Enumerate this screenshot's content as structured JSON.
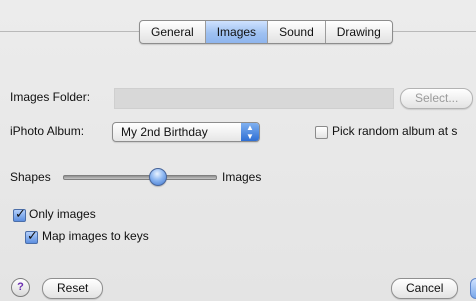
{
  "tabs": {
    "items": [
      {
        "label": "General",
        "active": false
      },
      {
        "label": "Images",
        "active": true
      },
      {
        "label": "Sound",
        "active": false
      },
      {
        "label": "Drawing",
        "active": false
      }
    ]
  },
  "images_folder": {
    "label": "Images Folder:",
    "value": "",
    "select_label": "Select..."
  },
  "iphoto": {
    "label": "iPhoto Album:",
    "selected": "My 2nd Birthday",
    "random_label": "Pick random album at s",
    "random_checked": false
  },
  "slider": {
    "left_label": "Shapes",
    "right_label": "Images",
    "value_fraction": 0.62
  },
  "options": {
    "only_images_label": "Only images",
    "only_images_checked": true,
    "map_images_label": "Map images to keys",
    "map_images_checked": true
  },
  "footer": {
    "help_label": "?",
    "reset_label": "Reset",
    "cancel_label": "Cancel"
  },
  "colors": {
    "accent": "#5d8fe0",
    "selected_tab": "#9fc1f1",
    "background": "#e8e8e8"
  },
  "icons": {
    "popup_arrows": "up-down-arrows-icon",
    "checkmark": "checkmark-icon",
    "help": "question-mark-icon"
  }
}
